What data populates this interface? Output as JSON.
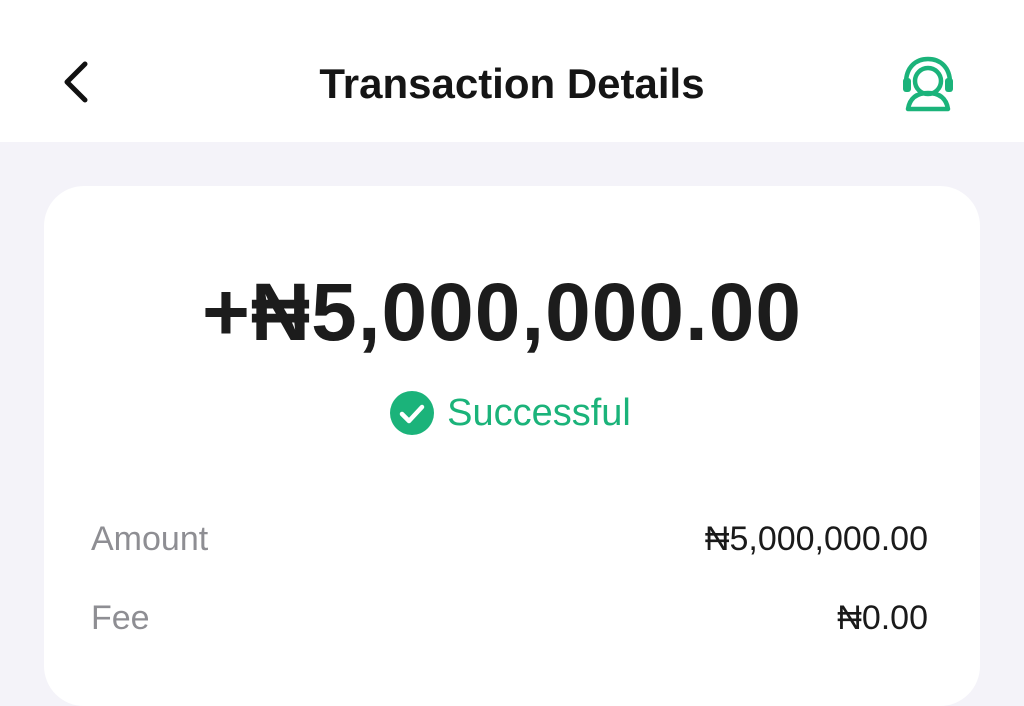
{
  "header": {
    "title": "Transaction Details",
    "back_icon": "chevron-left-icon",
    "support_icon": "customer-support-headset-icon"
  },
  "transaction": {
    "amount_display": "+₦5,000,000.00",
    "status": "Successful",
    "status_icon": "check-circle-icon",
    "details": [
      {
        "label": "Amount",
        "value": "₦5,000,000.00"
      },
      {
        "label": "Fee",
        "value": "₦0.00"
      }
    ]
  },
  "colors": {
    "accent_green": "#1bb37a",
    "page_background": "#f4f3f9",
    "card_background": "#ffffff",
    "label_gray": "#8e8e93"
  }
}
